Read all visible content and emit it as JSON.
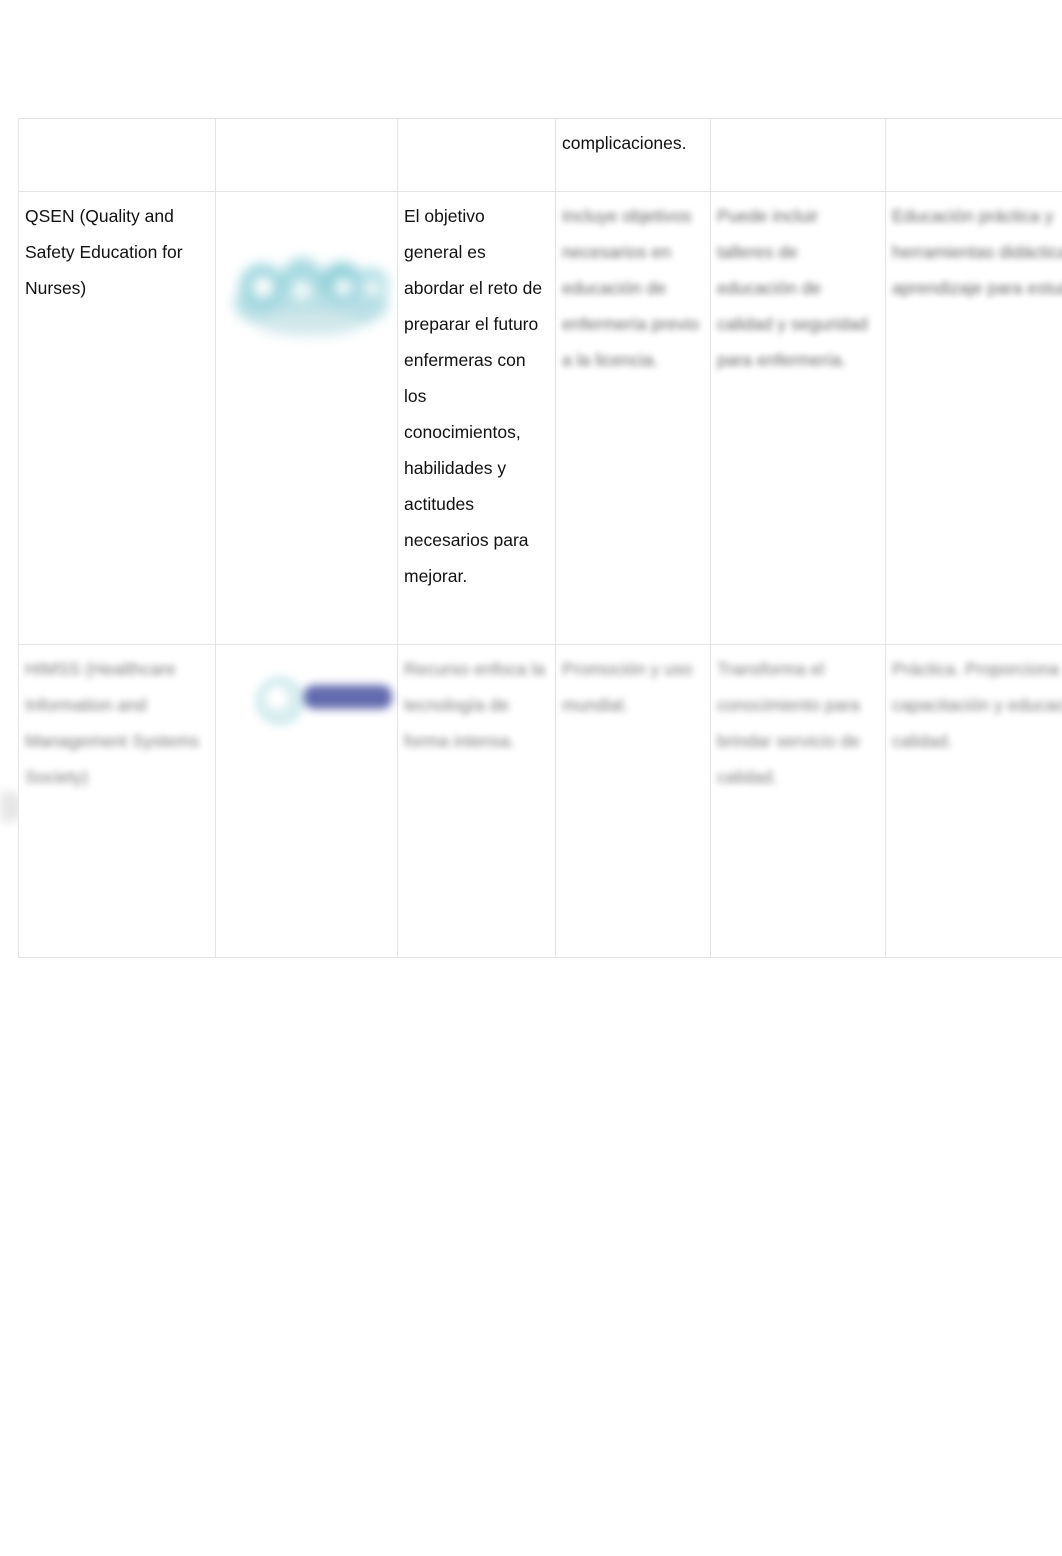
{
  "document": {
    "type": "table",
    "background_color": "#ffffff",
    "table_border_color": "#e3e3e3",
    "text_color": "#111111"
  },
  "table": {
    "column_count": 6,
    "rows": [
      {
        "id": "row-continuation",
        "kind": "continuation",
        "cells": [
          {
            "col": 1,
            "text": "",
            "blurred": false
          },
          {
            "col": 2,
            "text": "",
            "blurred": false
          },
          {
            "col": 3,
            "text": "",
            "blurred": false
          },
          {
            "col": 4,
            "text": "complicaciones.",
            "blurred": false
          },
          {
            "col": 5,
            "text": "",
            "blurred": false
          },
          {
            "col": 6,
            "text": "",
            "blurred": false
          }
        ]
      },
      {
        "id": "row-qsen",
        "kind": "content",
        "cells": [
          {
            "col": 1,
            "text": "QSEN (Quality and Safety Education for Nurses)",
            "blurred": false
          },
          {
            "col": 2,
            "text": "",
            "blurred": false,
            "logo": "qsen-logo"
          },
          {
            "col": 3,
            "text": "El objetivo general es abordar el reto de preparar el futuro enfermeras con los conocimientos, habilidades y actitudes necesarios para mejorar.",
            "blurred": false
          },
          {
            "col": 4,
            "text": "Incluye objetivos necesarios en educación de enfermería previo a la licencia.",
            "blurred": true
          },
          {
            "col": 5,
            "text": "Puede incluir talleres de educación de calidad y seguridad para enfermería.",
            "blurred": true
          },
          {
            "col": 6,
            "text": "Educación práctica y herramientas didácticas aprendizaje para estudiantes.",
            "blurred": true
          }
        ]
      },
      {
        "id": "row-himss",
        "kind": "content",
        "cells": [
          {
            "col": 1,
            "text": "HIMSS (Healthcare Information and Management Systems Society)",
            "blurred": true
          },
          {
            "col": 2,
            "text": "",
            "blurred": false,
            "logo": "himss-logo"
          },
          {
            "col": 3,
            "text": "Recurso enfoca la tecnología de forma intensa.",
            "blurred": true
          },
          {
            "col": 4,
            "text": "Promoción y uso mundial.",
            "blurred": true
          },
          {
            "col": 5,
            "text": "Transforma el conocimiento para brindar servicio de calidad.",
            "blurred": true
          },
          {
            "col": 6,
            "text": "Práctica. Proporciona capacitación y educación de calidad.",
            "blurred": true
          }
        ]
      }
    ]
  },
  "logos": {
    "qsen": {
      "name": "qsen-logo",
      "description": "QSEN cloud-shaped bubble logo",
      "primary_color": "#b4dde3",
      "accent_color": "#8fd0da",
      "blurred": true
    },
    "himss": {
      "name": "himss-logo",
      "description": "HIMSS circular mark with wordmark",
      "primary_color": "#d9eef0",
      "accent_color": "#5b63ab",
      "blurred": true
    }
  }
}
